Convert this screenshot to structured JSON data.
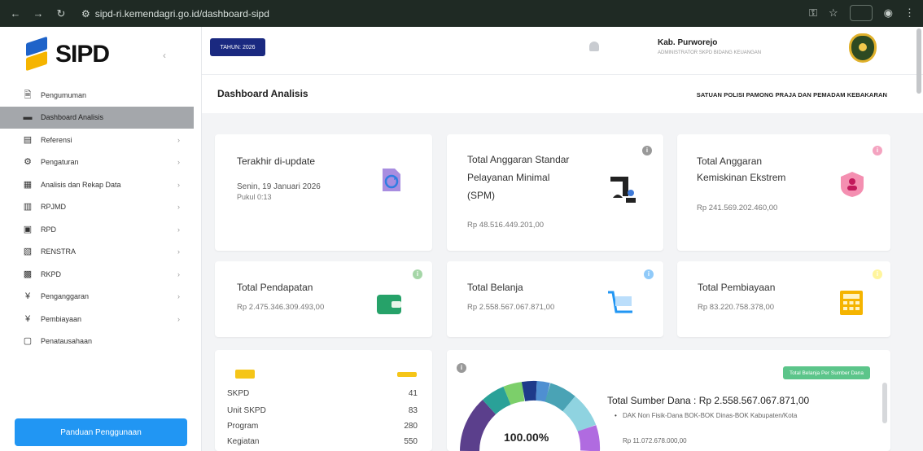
{
  "browser": {
    "url": "sipd-ri.kemendagri.go.id/dashboard-sipd"
  },
  "sidebar": {
    "logo_text": "SIPD",
    "items": [
      {
        "label": "Pengumuman",
        "icon": "announcement-icon",
        "has_chevron": false
      },
      {
        "label": "Dashboard Analisis",
        "icon": "dashboard-icon",
        "has_chevron": false,
        "active": true
      },
      {
        "label": "Referensi",
        "icon": "reference-icon",
        "has_chevron": true
      },
      {
        "label": "Pengaturan",
        "icon": "gear-icon",
        "has_chevron": true
      },
      {
        "label": "Analisis dan Rekap Data",
        "icon": "analysis-icon",
        "has_chevron": true
      },
      {
        "label": "RPJMD",
        "icon": "rpjmd-icon",
        "has_chevron": true
      },
      {
        "label": "RPD",
        "icon": "rpd-icon",
        "has_chevron": true
      },
      {
        "label": "RENSTRA",
        "icon": "renstra-icon",
        "has_chevron": true
      },
      {
        "label": "RKPD",
        "icon": "rkpd-icon",
        "has_chevron": true
      },
      {
        "label": "Penganggaran",
        "icon": "budgeting-icon",
        "has_chevron": true
      },
      {
        "label": "Pembiayaan",
        "icon": "financing-icon",
        "has_chevron": true
      },
      {
        "label": "Penatausahaan",
        "icon": "administration-icon",
        "has_chevron": false
      }
    ],
    "guide_button": "Panduan Penggunaan"
  },
  "header": {
    "year_badge": "TAHUN: 2026",
    "user_name": "Kab. Purworejo",
    "user_role": "ADMINISTRATOR SKPD BIDANG KEUANGAN"
  },
  "subheader": {
    "title": "Dashboard Analisis",
    "unit": "SATUAN POLISI PAMONG PRAJA DAN PEMADAM KEBAKARAN"
  },
  "cards": {
    "update": {
      "title": "Terakhir di-update",
      "date": "Senin, 19 Januari 2026",
      "time": "Pukul 0:13"
    },
    "spm": {
      "title_lines": [
        "Total Anggaran Standar",
        "Pelayanan Minimal",
        "(SPM)"
      ],
      "value": "Rp 48.516.449.201,00"
    },
    "kemiskinan": {
      "title_lines": [
        "Total Anggaran",
        "Kemiskinan Ekstrem"
      ],
      "value": "Rp 241.569.202.460,00"
    },
    "pendapatan": {
      "title": "Total Pendapatan",
      "value": "Rp 2.475.346.309.493,00"
    },
    "belanja": {
      "title": "Total Belanja",
      "value": "Rp 2.558.567.067.871,00"
    },
    "pembiayaan": {
      "title": "Total Pembiayaan",
      "value": "Rp 83.220.758.378,00"
    }
  },
  "stats": {
    "rows": [
      {
        "label": "SKPD",
        "value": "41"
      },
      {
        "label": "Unit SKPD",
        "value": "83"
      },
      {
        "label": "Program",
        "value": "280"
      },
      {
        "label": "Kegiatan",
        "value": "550"
      }
    ]
  },
  "sumber_dana": {
    "pill": "Total Belanja Per Sumber Dana",
    "percent": "100.00%",
    "title": "Total Sumber Dana : Rp 2.558.567.067.871,00",
    "item_label": "DAK Non Fisik-Dana BOK-BOK Dinas-BOK Kabupaten/Kota",
    "item_value": "Rp 11.072.678.000,00"
  },
  "colors": {
    "primary": "#2196f3",
    "navy": "#1a2980",
    "green": "#5cc58a",
    "yellow": "#f5c518",
    "purple": "#8e6bd1",
    "teal": "#4db6ac"
  }
}
